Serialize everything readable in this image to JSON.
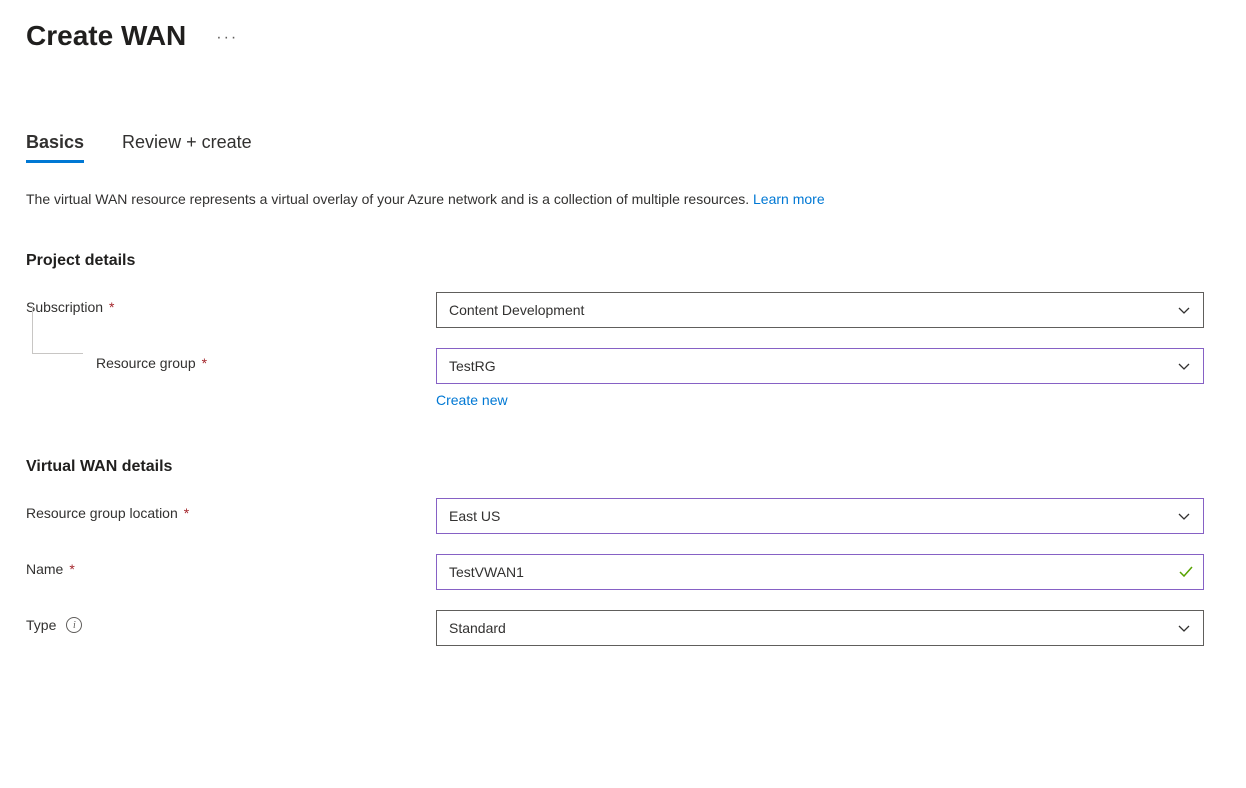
{
  "header": {
    "title": "Create WAN"
  },
  "tabs": {
    "basics": "Basics",
    "review": "Review + create"
  },
  "description": {
    "text": "The virtual WAN resource represents a virtual overlay of your Azure network and is a collection of multiple resources. ",
    "learn_more": "Learn more"
  },
  "sections": {
    "project_details": "Project details",
    "vwan_details": "Virtual WAN details"
  },
  "fields": {
    "subscription": {
      "label": "Subscription",
      "value": "Content Development"
    },
    "resource_group": {
      "label": "Resource group",
      "value": "TestRG",
      "create_new": "Create new"
    },
    "location": {
      "label": "Resource group location",
      "value": "East US"
    },
    "name": {
      "label": "Name",
      "value": "TestVWAN1"
    },
    "type": {
      "label": "Type",
      "value": "Standard"
    }
  }
}
